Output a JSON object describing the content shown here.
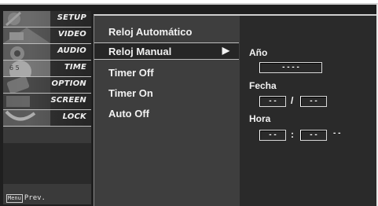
{
  "sidebar": {
    "categories": [
      {
        "label": "SETUP",
        "icon": "setup-icon"
      },
      {
        "label": "VIDEO",
        "icon": "video-icon"
      },
      {
        "label": "AUDIO",
        "icon": "audio-icon"
      },
      {
        "label": "TIME",
        "icon": "time-icon"
      },
      {
        "label": "OPTION",
        "icon": "option-icon"
      },
      {
        "label": "SCREEN",
        "icon": "screen-icon"
      },
      {
        "label": "LOCK",
        "icon": "lock-icon"
      }
    ],
    "menu_key": "Menu",
    "prev_label": "Prev."
  },
  "menu": {
    "items": [
      {
        "label": "Reloj Automático"
      },
      {
        "label": "Reloj Manual",
        "arrow": "▶"
      },
      {
        "label": "Timer Off"
      },
      {
        "label": "Timer On"
      },
      {
        "label": "Auto Off"
      }
    ]
  },
  "panel": {
    "year_label": "Año",
    "year_value": "- - - -",
    "date_label": "Fecha",
    "date_month": "- -",
    "date_sep": "/",
    "date_day": "- -",
    "time_label": "Hora",
    "time_hour": "- -",
    "time_sep": ":",
    "time_minute": "- -",
    "time_ampm": "- -"
  },
  "colors": {
    "background": "#1f1f1f",
    "text": "#f2f2f2",
    "highlight": "#262626"
  }
}
